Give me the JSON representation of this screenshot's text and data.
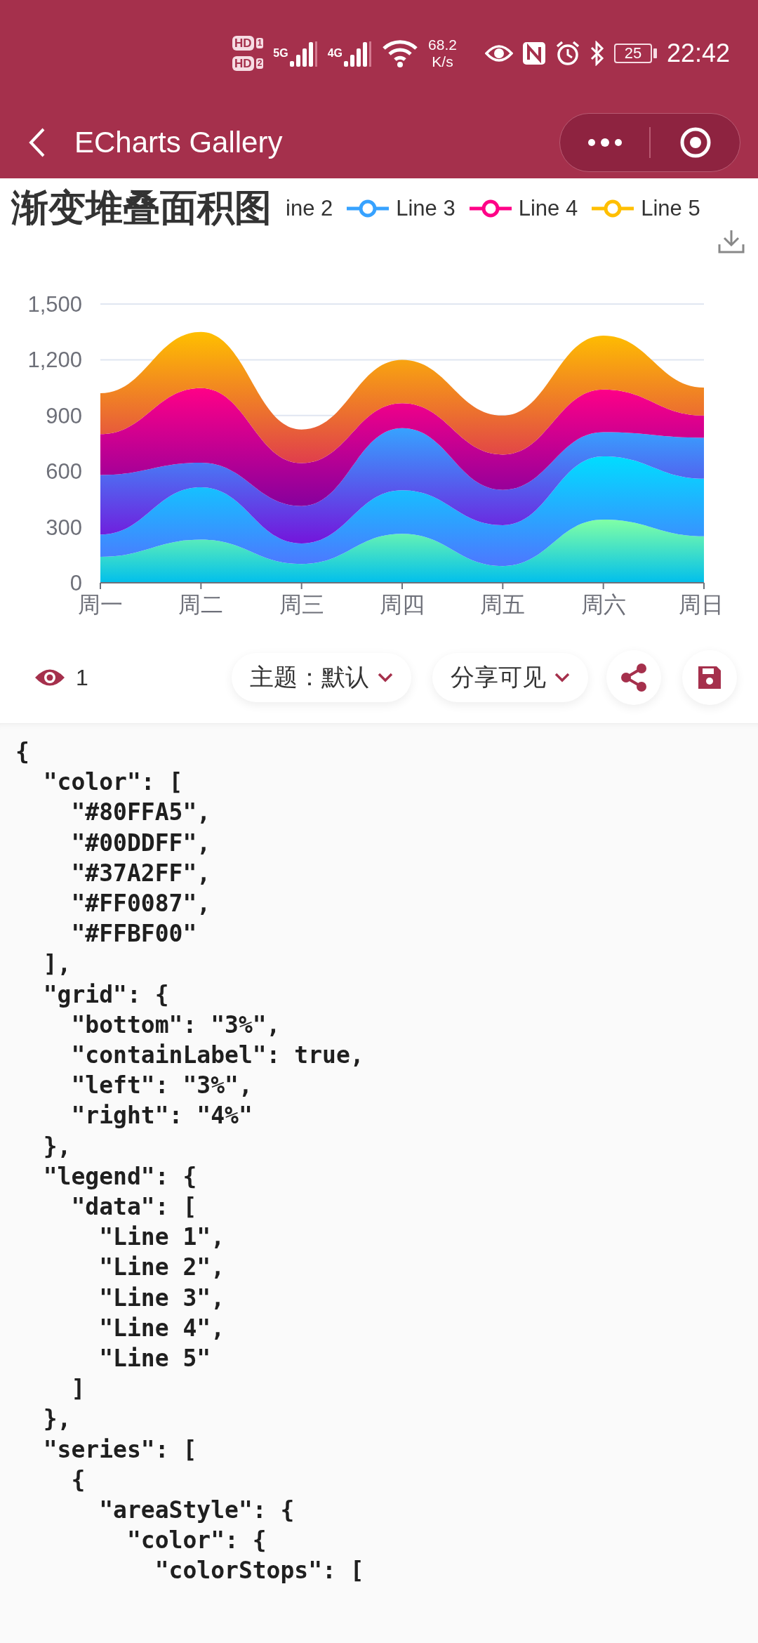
{
  "status_bar": {
    "hd_badges": [
      {
        "label": "HD",
        "slot": "1"
      },
      {
        "label": "HD",
        "slot": "2"
      }
    ],
    "networks": [
      "5G",
      "4G"
    ],
    "net_speed": [
      "68.2",
      "K/s"
    ],
    "battery": "25",
    "time": "22:42"
  },
  "nav": {
    "title": "ECharts Gallery"
  },
  "chart_section": {
    "title": "渐变堆叠面积图",
    "legend": [
      {
        "label": "ine 2",
        "kind": "cut"
      },
      {
        "label": "Line 3",
        "kind": "marker",
        "color": "#37A2FF"
      },
      {
        "label": "Line 4",
        "kind": "marker",
        "color": "#FF0087"
      },
      {
        "label": "Line 5",
        "kind": "marker",
        "color": "#FFBF00"
      }
    ],
    "chart_data": {
      "type": "area",
      "stacked": true,
      "grid": true,
      "categories": [
        "周一",
        "周二",
        "周三",
        "周四",
        "周五",
        "周六",
        "周日"
      ],
      "ylim": [
        0,
        1500
      ],
      "yticks": [
        0,
        300,
        600,
        900,
        {
          "value": 1200,
          "label": "1,200"
        },
        {
          "value": 1500,
          "label": "1,500"
        }
      ],
      "series": [
        {
          "color": "#80FFA5",
          "values": [
            140,
            232,
            101,
            264,
            90,
            340,
            250
          ]
        },
        {
          "color": "#00DDFF",
          "values": [
            120,
            282,
            111,
            234,
            220,
            340,
            310
          ]
        },
        {
          "color": "#37A2FF",
          "values": [
            320,
            132,
            201,
            334,
            190,
            130,
            220
          ]
        },
        {
          "color": "#FF0087",
          "values": [
            220,
            402,
            231,
            134,
            190,
            230,
            120
          ]
        },
        {
          "color": "#FFBF00",
          "values": [
            220,
            302,
            181,
            234,
            210,
            290,
            150
          ]
        }
      ]
    }
  },
  "toolbar": {
    "views": "1",
    "theme": "主题：默认",
    "share": "分享可见"
  },
  "code_lines": [
    "{",
    "  \"color\": [",
    "    \"#80FFA5\",",
    "    \"#00DDFF\",",
    "    \"#37A2FF\",",
    "    \"#FF0087\",",
    "    \"#FFBF00\"",
    "  ],",
    "  \"grid\": {",
    "    \"bottom\": \"3%\",",
    "    \"containLabel\": true,",
    "    \"left\": \"3%\",",
    "    \"right\": \"4%\"",
    "  },",
    "  \"legend\": {",
    "    \"data\": [",
    "      \"Line 1\",",
    "      \"Line 2\",",
    "      \"Line 3\",",
    "      \"Line 4\",",
    "      \"Line 5\"",
    "    ]",
    "  },",
    "  \"series\": [",
    "    {",
    "      \"areaStyle\": {",
    "        \"color\": {",
    "          \"colorStops\": ["
  ]
}
